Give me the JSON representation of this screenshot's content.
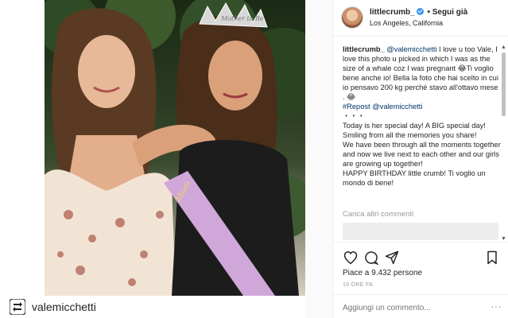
{
  "post": {
    "repost_username": "valemicchetti",
    "image_text": {
      "tiara": "Mother to Be",
      "sash": "Mom"
    }
  },
  "header": {
    "username": "littlecrumb_",
    "follow_label": "• Segui già",
    "location": "Los Angeles, California"
  },
  "caption": {
    "username": "littlecrumb_",
    "mention_1": "@valemicchetti",
    "text_1": " I love u too Vale, I love this photo u picked in which I was as the size of a whale coz I was pregnant 😂Ti voglio bene anche io! Bella la foto che hai scelto in cui io pensavo 200 kg perché stavo all'ottavo mese . 😂",
    "repost_tag": "#Repost",
    "mention_2": "@valemicchetti",
    "dots": "・・・",
    "line_1": "Today is her special day! A BIG special day!",
    "line_2": "Smiling from all the memories you share!",
    "line_3": "We have been through all the moments together and now we live next to each other and our girls are growing up together!",
    "line_4": "HAPPY BIRTHDAY little crumb! Ti voglio un mondo di bene!"
  },
  "comments": {
    "load_more": "Carica altri commenti"
  },
  "actions": {
    "icons": [
      "heart-icon",
      "comment-icon",
      "share-icon",
      "bookmark-icon"
    ],
    "likes_text": "Piace a 9.432 persone",
    "time_ago": "10 ORE FA"
  },
  "comment_box": {
    "placeholder": "Aggiungi un commento...",
    "more": "···"
  },
  "colors": {
    "verified_blue": "#3897f0",
    "mention_blue": "#003569",
    "border": "#efefef",
    "secondary_text": "#999999"
  }
}
